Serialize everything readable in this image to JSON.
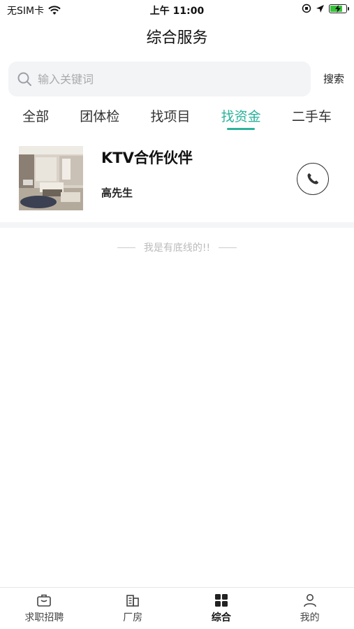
{
  "status_bar": {
    "carrier": "无SIM卡",
    "time": "上午 11:00",
    "battery_level": 0.8,
    "battery_color": "#39c23c"
  },
  "nav": {
    "title": "综合服务"
  },
  "search": {
    "placeholder": "输入关键词",
    "value": "",
    "button_label": "搜索"
  },
  "tabs": [
    {
      "label": "全部",
      "active": false
    },
    {
      "label": "团体检",
      "active": false
    },
    {
      "label": "找项目",
      "active": false
    },
    {
      "label": "找资金",
      "active": true
    },
    {
      "label": "二手车",
      "active": false
    }
  ],
  "accent_color": "#2bb39c",
  "listing": {
    "title": "KTV合作伙伴",
    "contact": "高先生",
    "icon": "phone-icon"
  },
  "footer_note": "我是有底线的!!",
  "tabbar": [
    {
      "label": "求职招聘",
      "icon": "briefcase-icon",
      "active": false
    },
    {
      "label": "厂房",
      "icon": "building-icon",
      "active": false
    },
    {
      "label": "综合",
      "icon": "grid-icon",
      "active": true
    },
    {
      "label": "我的",
      "icon": "person-icon",
      "active": false
    }
  ]
}
